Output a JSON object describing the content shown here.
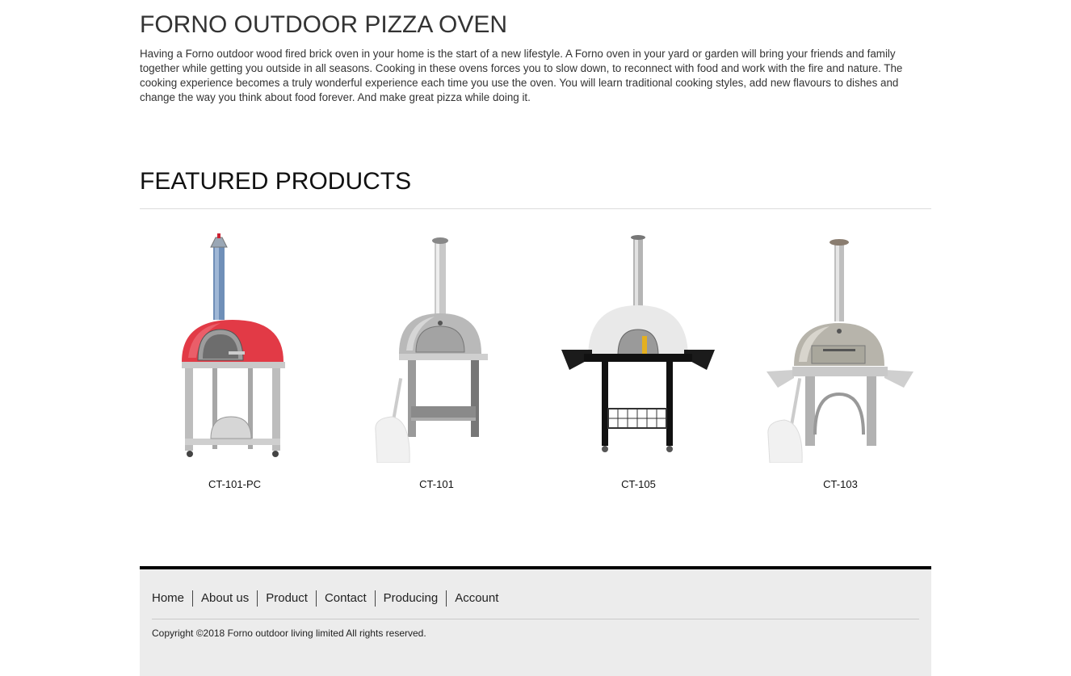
{
  "intro": {
    "title": "FORNO OUTDOOR PIZZA OVEN",
    "text": "Having a Forno outdoor wood fired brick oven in your home is the start of a new lifestyle. A Forno oven in your yard or garden will bring your friends and family together while getting you outside in all seasons. Cooking in these ovens forces you to slow down, to reconnect with food and work with the fire and nature. The cooking experience becomes a truly wonderful experience each time you use the oven. You will learn traditional cooking styles, add new flavours to dishes and change the way you think about food forever. And make great pizza while doing it."
  },
  "featured": {
    "title": "FEATURED PRODUCTS",
    "products": [
      {
        "name": "CT-101-PC",
        "color": "#e23a46"
      },
      {
        "name": "CT-101",
        "color": "#b9b9b9"
      },
      {
        "name": "CT-105",
        "color": "#e9e9e9"
      },
      {
        "name": "CT-103",
        "color": "#b7b4ab"
      }
    ]
  },
  "footer": {
    "nav": [
      "Home",
      "About us",
      "Product",
      "Contact",
      "Producing",
      "Account"
    ],
    "copyright": "Copyright ©2018 Forno outdoor living limited All rights reserved."
  }
}
